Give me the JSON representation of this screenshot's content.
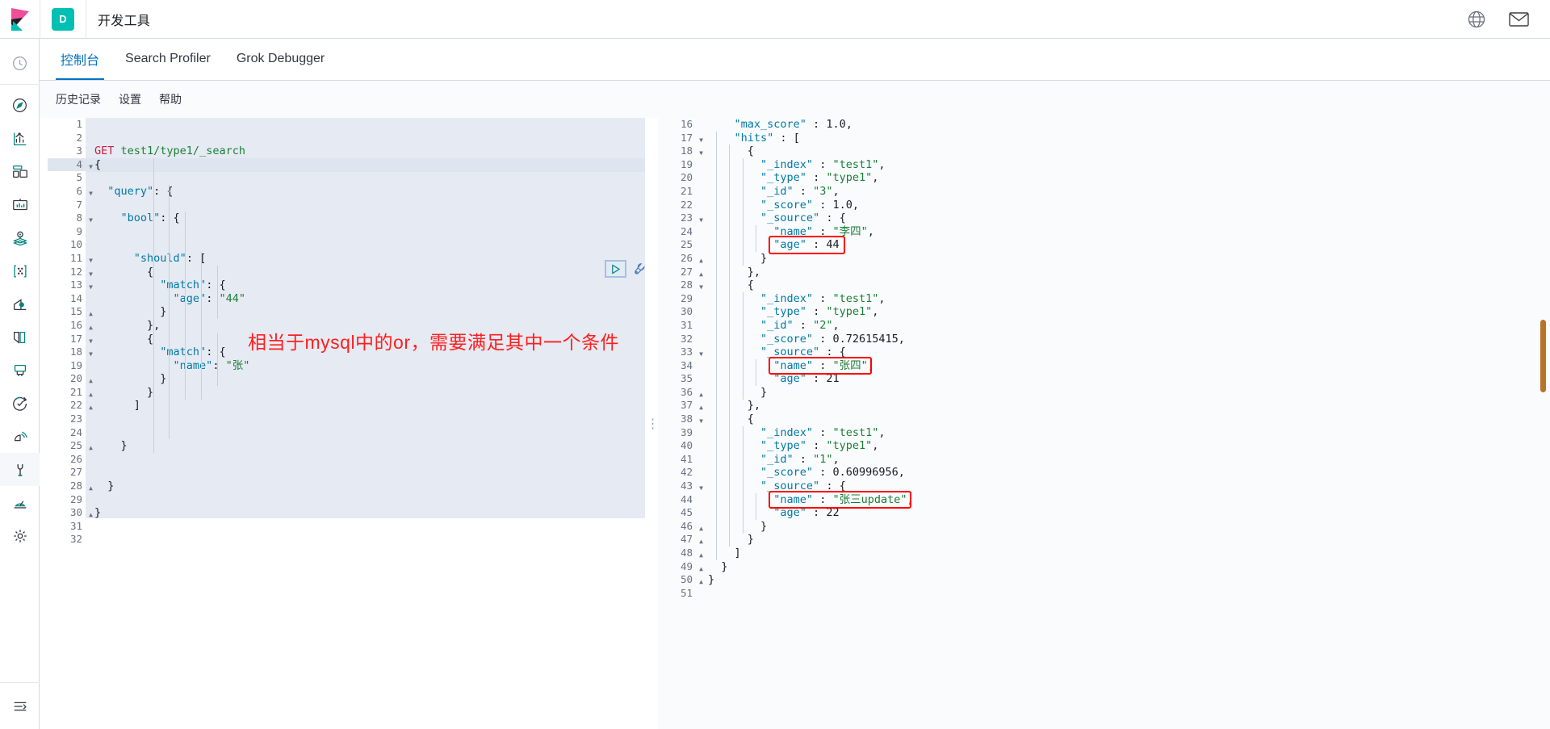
{
  "header": {
    "logo_name": "kibana-logo",
    "space_badge": "D",
    "title": "开发工具",
    "icons": [
      {
        "name": "help-icon",
        "glyph": "?"
      },
      {
        "name": "mail-icon",
        "glyph": "✉"
      }
    ]
  },
  "sidebar": {
    "items": [
      {
        "name": "recently-viewed-icon",
        "label": "最近访问"
      },
      {
        "name": "discover-icon",
        "label": "Discover"
      },
      {
        "name": "visualize-icon",
        "label": "Visualize"
      },
      {
        "name": "dashboard-icon",
        "label": "Dashboard"
      },
      {
        "name": "canvas-icon",
        "label": "Canvas"
      },
      {
        "name": "maps-icon",
        "label": "Maps"
      },
      {
        "name": "machine-learning-icon",
        "label": "Machine Learning"
      },
      {
        "name": "infrastructure-icon",
        "label": "Infrastructure"
      },
      {
        "name": "logs-icon",
        "label": "Logs"
      },
      {
        "name": "apm-icon",
        "label": "APM"
      },
      {
        "name": "uptime-icon",
        "label": "Uptime"
      },
      {
        "name": "siem-icon",
        "label": "SIEM"
      },
      {
        "name": "dev-tools-icon",
        "label": "开发工具",
        "selected": true
      },
      {
        "name": "monitoring-icon",
        "label": "Monitoring"
      },
      {
        "name": "management-icon",
        "label": "Management"
      }
    ],
    "collapse": {
      "name": "collapse-nav-icon",
      "label": "折叠"
    }
  },
  "tabs": [
    {
      "name": "tab-console",
      "label": "控制台",
      "active": true
    },
    {
      "name": "tab-search-profiler",
      "label": "Search Profiler",
      "active": false
    },
    {
      "name": "tab-grok-debugger",
      "label": "Grok Debugger",
      "active": false
    }
  ],
  "subnav": [
    {
      "name": "subnav-history",
      "label": "历史记录"
    },
    {
      "name": "subnav-settings",
      "label": "设置"
    },
    {
      "name": "subnav-help",
      "label": "帮助"
    }
  ],
  "actions": {
    "run_label": "▷",
    "run_name": "run-query-button",
    "wrench_name": "wrench-icon"
  },
  "annotation": {
    "text": "相当于mysql中的or，需要满足其中一个条件",
    "color": "#ff1f1f"
  },
  "request_editor": {
    "current_line": 4,
    "total_lines": 32,
    "lines": [
      {
        "n": 1,
        "text": "",
        "fold": ""
      },
      {
        "n": 2,
        "text": "",
        "fold": ""
      },
      {
        "n": 3,
        "text": "GET test1/type1/_search",
        "fold": ""
      },
      {
        "n": 4,
        "text": "{",
        "fold": "down"
      },
      {
        "n": 5,
        "text": "",
        "fold": ""
      },
      {
        "n": 6,
        "text": "  \"query\": {",
        "fold": "down"
      },
      {
        "n": 7,
        "text": "",
        "fold": ""
      },
      {
        "n": 8,
        "text": "    \"bool\": {",
        "fold": "down"
      },
      {
        "n": 9,
        "text": "",
        "fold": ""
      },
      {
        "n": 10,
        "text": "",
        "fold": ""
      },
      {
        "n": 11,
        "text": "      \"should\": [",
        "fold": "down"
      },
      {
        "n": 12,
        "text": "        {",
        "fold": "down"
      },
      {
        "n": 13,
        "text": "          \"match\": {",
        "fold": "down"
      },
      {
        "n": 14,
        "text": "            \"age\": \"44\"",
        "fold": ""
      },
      {
        "n": 15,
        "text": "          }",
        "fold": "up"
      },
      {
        "n": 16,
        "text": "        },",
        "fold": "up"
      },
      {
        "n": 17,
        "text": "        {",
        "fold": "down"
      },
      {
        "n": 18,
        "text": "          \"match\": {",
        "fold": "down"
      },
      {
        "n": 19,
        "text": "            \"name\": \"张\"",
        "fold": ""
      },
      {
        "n": 20,
        "text": "          }",
        "fold": "up"
      },
      {
        "n": 21,
        "text": "        }",
        "fold": "up"
      },
      {
        "n": 22,
        "text": "      ]",
        "fold": "up"
      },
      {
        "n": 23,
        "text": "",
        "fold": ""
      },
      {
        "n": 24,
        "text": "",
        "fold": ""
      },
      {
        "n": 25,
        "text": "    }",
        "fold": "up"
      },
      {
        "n": 26,
        "text": "",
        "fold": ""
      },
      {
        "n": 27,
        "text": "",
        "fold": ""
      },
      {
        "n": 28,
        "text": "  }",
        "fold": "up"
      },
      {
        "n": 29,
        "text": "",
        "fold": ""
      },
      {
        "n": 30,
        "text": "}",
        "fold": "up"
      },
      {
        "n": 31,
        "text": "",
        "fold": ""
      },
      {
        "n": 32,
        "text": "",
        "fold": ""
      }
    ]
  },
  "response_editor": {
    "first_line": 16,
    "last_line": 51,
    "lines": [
      {
        "n": 16,
        "text": "    \"max_score\" : 1.0,",
        "fold": ""
      },
      {
        "n": 17,
        "text": "    \"hits\" : [",
        "fold": "down"
      },
      {
        "n": 18,
        "text": "      {",
        "fold": "down"
      },
      {
        "n": 19,
        "text": "        \"_index\" : \"test1\",",
        "fold": ""
      },
      {
        "n": 20,
        "text": "        \"_type\" : \"type1\",",
        "fold": ""
      },
      {
        "n": 21,
        "text": "        \"_id\" : \"3\",",
        "fold": ""
      },
      {
        "n": 22,
        "text": "        \"_score\" : 1.0,",
        "fold": ""
      },
      {
        "n": 23,
        "text": "        \"_source\" : {",
        "fold": "down"
      },
      {
        "n": 24,
        "text": "          \"name\" : \"李四\",",
        "fold": ""
      },
      {
        "n": 25,
        "text": "          \"age\" : 44",
        "fold": ""
      },
      {
        "n": 26,
        "text": "        }",
        "fold": "up"
      },
      {
        "n": 27,
        "text": "      },",
        "fold": "up"
      },
      {
        "n": 28,
        "text": "      {",
        "fold": "down"
      },
      {
        "n": 29,
        "text": "        \"_index\" : \"test1\",",
        "fold": ""
      },
      {
        "n": 30,
        "text": "        \"_type\" : \"type1\",",
        "fold": ""
      },
      {
        "n": 31,
        "text": "        \"_id\" : \"2\",",
        "fold": ""
      },
      {
        "n": 32,
        "text": "        \"_score\" : 0.72615415,",
        "fold": ""
      },
      {
        "n": 33,
        "text": "        \"_source\" : {",
        "fold": "down"
      },
      {
        "n": 34,
        "text": "          \"name\" : \"张四\",",
        "fold": ""
      },
      {
        "n": 35,
        "text": "          \"age\" : 21",
        "fold": ""
      },
      {
        "n": 36,
        "text": "        }",
        "fold": "up"
      },
      {
        "n": 37,
        "text": "      },",
        "fold": "up"
      },
      {
        "n": 38,
        "text": "      {",
        "fold": "down"
      },
      {
        "n": 39,
        "text": "        \"_index\" : \"test1\",",
        "fold": ""
      },
      {
        "n": 40,
        "text": "        \"_type\" : \"type1\",",
        "fold": ""
      },
      {
        "n": 41,
        "text": "        \"_id\" : \"1\",",
        "fold": ""
      },
      {
        "n": 42,
        "text": "        \"_score\" : 0.60996956,",
        "fold": ""
      },
      {
        "n": 43,
        "text": "        \"_source\" : {",
        "fold": "down"
      },
      {
        "n": 44,
        "text": "          \"name\" : \"张三update\",",
        "fold": ""
      },
      {
        "n": 45,
        "text": "          \"age\" : 22",
        "fold": ""
      },
      {
        "n": 46,
        "text": "        }",
        "fold": "up"
      },
      {
        "n": 47,
        "text": "      }",
        "fold": "up"
      },
      {
        "n": 48,
        "text": "    ]",
        "fold": "up"
      },
      {
        "n": 49,
        "text": "  }",
        "fold": "up"
      },
      {
        "n": 50,
        "text": "}",
        "fold": "up"
      },
      {
        "n": 51,
        "text": "",
        "fold": ""
      }
    ],
    "highlights": [
      {
        "name": "highlight-age-44",
        "line": 25,
        "value": "\"age\" : 44"
      },
      {
        "name": "highlight-name-zhangsi",
        "line": 34,
        "value": "\"name\" : \"张四\","
      },
      {
        "name": "highlight-name-zhangsan-update",
        "line": 44,
        "value": "\"name\" : \"张三update\","
      }
    ]
  }
}
